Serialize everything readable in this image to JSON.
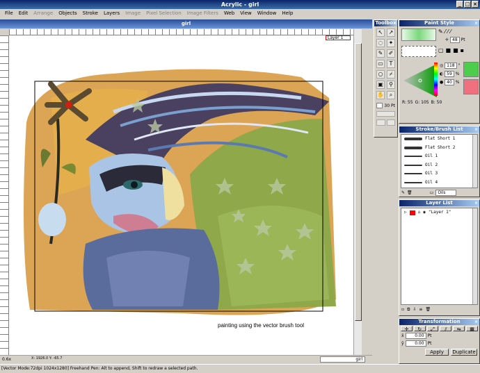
{
  "app": {
    "title": "Acrylic - girl"
  },
  "menu": [
    "File",
    "Edit",
    "Arrange",
    "Objects",
    "Stroke",
    "Layers",
    "Image",
    "Pixel Selection",
    "Image Filters",
    "Web",
    "View",
    "Window",
    "Help"
  ],
  "menu_disabled": [
    "Arrange",
    "Image",
    "Pixel Selection",
    "Image Filters"
  ],
  "document": {
    "title": "girl",
    "layer_chip": "Layer 1",
    "caption": "painting using the vector brush tool",
    "zoom": "0.6x",
    "coords": "X: 1926.0 Y: -65.7",
    "tab_name": "girl"
  },
  "status": {
    "text": "[Vector Mode:72dpi 1024x1280]     Freehand Pen: Alt to append, Shift to redraw a selected path."
  },
  "toolbox": {
    "title": "Toolbox",
    "size_value": "30",
    "size_unit": "Pt"
  },
  "paint_style": {
    "title": "Paint Style",
    "width_value": "48",
    "width_unit": "Pt",
    "h": "118",
    "s": "59",
    "v": "40",
    "r": "55",
    "g": "105",
    "b": "50",
    "pct": "%",
    "deg": "°"
  },
  "stroke_list": {
    "title": "Stroke/Brush List",
    "items": [
      "Flat Short 1",
      "Flat Short 2",
      "Oil 1",
      "Oil 2",
      "Oil 3",
      "Oil 4"
    ],
    "category": "Oils"
  },
  "layer_list": {
    "title": "Layer List",
    "layer": "\"Layer 1\""
  },
  "transformation": {
    "title": "Transformation",
    "x": "0.00",
    "y": "0.00",
    "w": "0.00",
    "h": "0.00",
    "unit": "Pt",
    "apply": "Apply",
    "duplicate": "Duplicate"
  },
  "colors": {
    "accent": "#0a246a",
    "fill_green": "#4ccd4c",
    "stroke_pink": "#f07080",
    "layer_red": "#ff0000"
  }
}
